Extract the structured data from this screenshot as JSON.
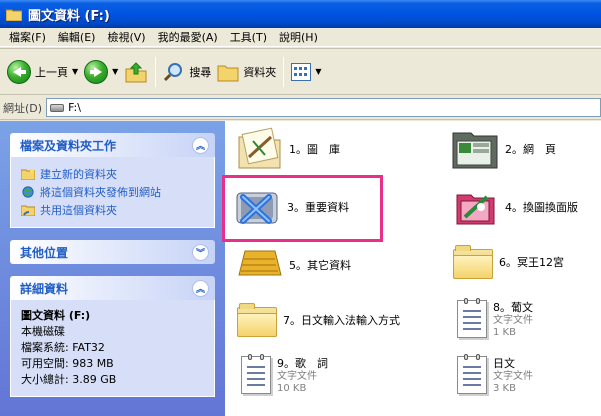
{
  "window": {
    "title": "圖文資料 (F:)"
  },
  "menu": [
    "檔案(F)",
    "編輯(E)",
    "檢視(V)",
    "我的最愛(A)",
    "工具(T)",
    "說明(H)"
  ],
  "toolbar": {
    "back": "上一頁",
    "search": "搜尋",
    "folders": "資料夾"
  },
  "address": {
    "label": "網址(D)",
    "value": "F:\\"
  },
  "left": {
    "tasks": {
      "title": "檔案及資料夾工作",
      "items": [
        "建立新的資料夾",
        "將這個資料夾發佈到網站",
        "共用這個資料夾"
      ]
    },
    "other": {
      "title": "其他位置"
    },
    "details": {
      "title": "詳細資料",
      "name": "圖文資料 (F:)",
      "type": "本機磁碟",
      "fs": "檔案系統: FAT32",
      "free": "可用空間: 983 MB",
      "total": "大小總計: 3.89 GB"
    }
  },
  "items": [
    {
      "name": "1。圖　庫"
    },
    {
      "name": "2。網　頁"
    },
    {
      "name": "3。重要資料"
    },
    {
      "name": "4。換圖換面版"
    },
    {
      "name": "5。其它資料"
    },
    {
      "name": "6。冥王12宮"
    },
    {
      "name": "7。日文輸入法輸入方式"
    },
    {
      "name": "8。葡文",
      "type": "文字文件",
      "size": "1 KB"
    },
    {
      "name": "9。歌　詞",
      "type": "文字文件",
      "size": "10 KB"
    },
    {
      "name": "日文",
      "type": "文字文件",
      "size": "3 KB"
    }
  ],
  "colors": {
    "highlight": "#e8308b",
    "link": "#215dc6",
    "titlebar": "#0054e3"
  }
}
